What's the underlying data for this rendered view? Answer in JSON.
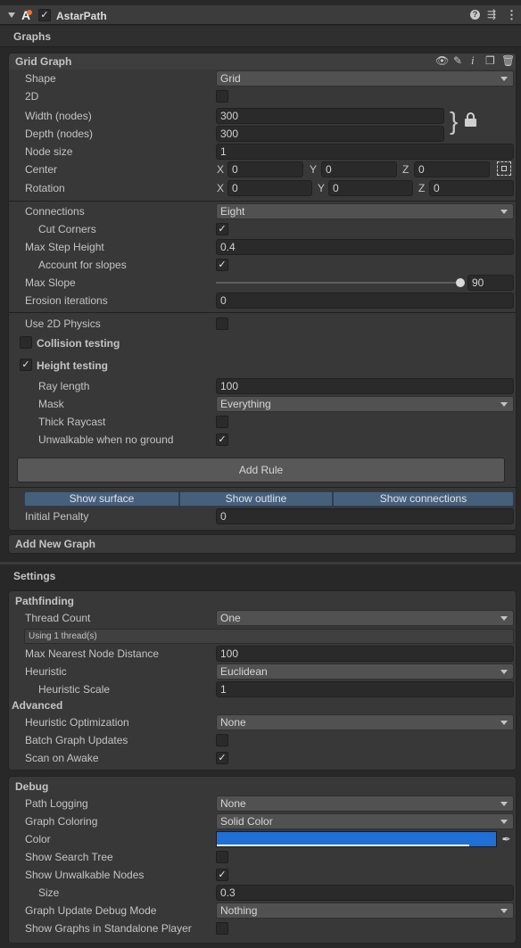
{
  "component": {
    "title": "AstarPath",
    "enabled_mark": "✓"
  },
  "header_icons": [
    "help-icon",
    "settings-icon",
    "more-vertical-icon"
  ],
  "graphs": {
    "heading": "Graphs",
    "grid_graph": {
      "title": "Grid Graph",
      "shape": {
        "label": "Shape",
        "value": "Grid"
      },
      "is2d": {
        "label": "2D",
        "checked": ""
      },
      "width": {
        "label": "Width (nodes)",
        "value": "300"
      },
      "depth": {
        "label": "Depth (nodes)",
        "value": "300"
      },
      "node_size": {
        "label": "Node size",
        "value": "1"
      },
      "center": {
        "label": "Center",
        "x_label": "X",
        "y_label": "Y",
        "z_label": "Z",
        "x": "0",
        "y": "0",
        "z": "0"
      },
      "rotation": {
        "label": "Rotation",
        "x_label": "X",
        "y_label": "Y",
        "z_label": "Z",
        "x": "0",
        "y": "0",
        "z": "0"
      },
      "connections": {
        "label": "Connections",
        "value": "Eight"
      },
      "cut_corners": {
        "label": "Cut Corners",
        "checked": "✓"
      },
      "max_step_height": {
        "label": "Max Step Height",
        "value": "0.4"
      },
      "account_slopes": {
        "label": "Account for slopes",
        "checked": "✓"
      },
      "max_slope": {
        "label": "Max Slope",
        "value": "90",
        "fraction": 1.0
      },
      "erosion": {
        "label": "Erosion iterations",
        "value": "0"
      },
      "use2d_physics": {
        "label": "Use 2D Physics",
        "checked": ""
      },
      "collision": {
        "label": "Collision testing",
        "checked": ""
      },
      "height": {
        "label": "Height testing",
        "checked": "✓"
      },
      "ray_length": {
        "label": "Ray length",
        "value": "100"
      },
      "mask": {
        "label": "Mask",
        "value": "Everything"
      },
      "thick_raycast": {
        "label": "Thick Raycast",
        "checked": ""
      },
      "unwalkable_no_ground": {
        "label": "Unwalkable when no ground",
        "checked": "✓"
      },
      "add_rule": "Add Rule",
      "show_surface": "Show surface",
      "show_outline": "Show outline",
      "show_connections": "Show connections",
      "initial_penalty": {
        "label": "Initial Penalty",
        "value": "0"
      }
    },
    "add_new_graph": "Add New Graph"
  },
  "settings": {
    "heading": "Settings",
    "pathfinding": {
      "title": "Pathfinding",
      "thread_count": {
        "label": "Thread Count",
        "value": "One"
      },
      "thread_info": "Using 1 thread(s)",
      "max_nearest": {
        "label": "Max Nearest Node Distance",
        "value": "100"
      },
      "heuristic": {
        "label": "Heuristic",
        "value": "Euclidean"
      },
      "heuristic_scale": {
        "label": "Heuristic Scale",
        "value": "1"
      },
      "advanced": "Advanced",
      "heuristic_opt": {
        "label": "Heuristic Optimization",
        "value": "None"
      },
      "batch_updates": {
        "label": "Batch Graph Updates",
        "checked": ""
      },
      "scan_on_awake": {
        "label": "Scan on Awake",
        "checked": "✓"
      }
    },
    "debug": {
      "title": "Debug",
      "path_logging": {
        "label": "Path Logging",
        "value": "None"
      },
      "graph_coloring": {
        "label": "Graph Coloring",
        "value": "Solid Color"
      },
      "color": {
        "label": "Color",
        "hex": "#1f6fd6"
      },
      "show_search_tree": {
        "label": "Show Search Tree",
        "checked": ""
      },
      "show_unwalkable": {
        "label": "Show Unwalkable Nodes",
        "checked": "✓"
      },
      "size": {
        "label": "Size",
        "value": "0.3"
      },
      "update_debug_mode": {
        "label": "Graph Update Debug Mode",
        "value": "Nothing"
      },
      "show_standalone": {
        "label": "Show Graphs in Standalone Player",
        "checked": ""
      }
    }
  }
}
